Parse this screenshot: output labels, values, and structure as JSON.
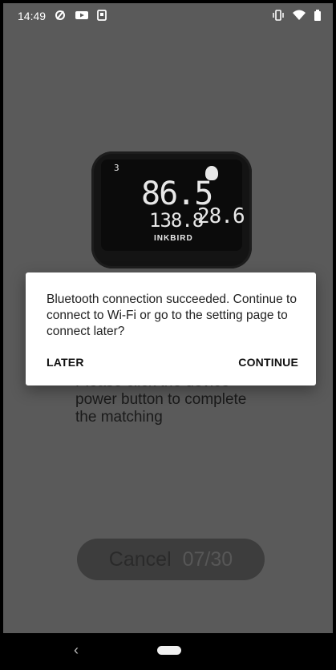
{
  "status_bar": {
    "time": "14:49",
    "left_icons": [
      "no-data-icon",
      "youtube-icon",
      "notification-icon"
    ],
    "right_icons": [
      "vibrate-icon",
      "wifi-icon",
      "battery-icon"
    ]
  },
  "device_display": {
    "main_reading": "86.5",
    "small_reading": "138.8",
    "right_reading": "28.6",
    "brand": "INKBIRD",
    "top_label": "3"
  },
  "background_text": "Please click the device power button to complete the matching",
  "cancel_button": {
    "label": "Cancel",
    "counter": "07/30"
  },
  "dialog": {
    "message": "Bluetooth connection succeeded. Continue to connect to Wi-Fi or go to the setting page to connect later?",
    "later_label": "LATER",
    "continue_label": "CONTINUE"
  },
  "navbar": {
    "back_glyph": "‹"
  }
}
